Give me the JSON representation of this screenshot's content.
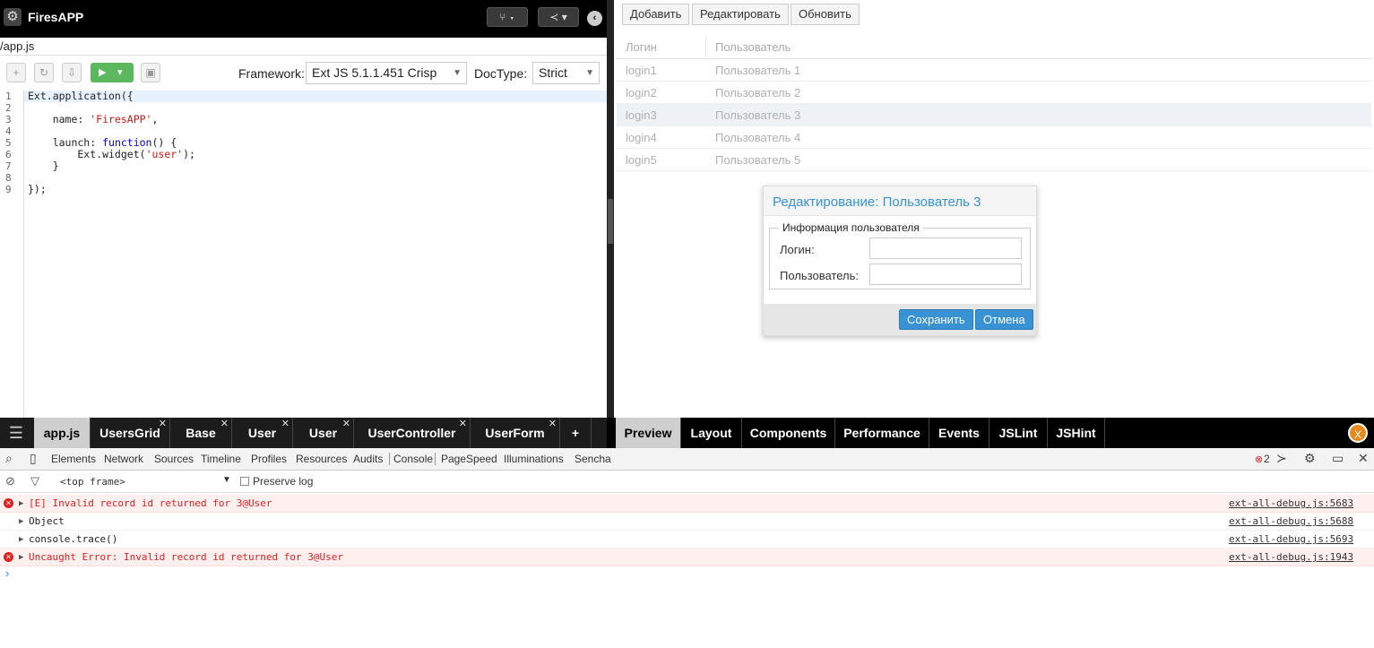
{
  "app": {
    "title": "FiresAPP",
    "gear_icon": "gear-icon",
    "file_path": "/app.js"
  },
  "toolbar": {
    "framework_label": "Framework:",
    "framework_value": "Ext JS 5.1.1.451 Crisp",
    "doctype_label": "DocType:",
    "doctype_value": "Strict"
  },
  "editor": {
    "line_numbers": [
      "1",
      "2",
      "3",
      "4",
      "5",
      "6",
      "7",
      "8",
      "9"
    ],
    "lines": [
      "Ext.application({",
      "",
      "    name: 'FiresAPP',",
      "",
      "    launch: function() {",
      "        Ext.widget('user');",
      "    }",
      "",
      "});"
    ]
  },
  "preview": {
    "buttons": [
      "Добавить",
      "Редактировать",
      "Обновить"
    ],
    "grid": {
      "columns": [
        "Логин",
        "Пользователь"
      ],
      "rows": [
        {
          "login": "login1",
          "user": "Пользователь 1"
        },
        {
          "login": "login2",
          "user": "Пользователь 2"
        },
        {
          "login": "login3",
          "user": "Пользователь 3"
        },
        {
          "login": "login4",
          "user": "Пользователь 4"
        },
        {
          "login": "login5",
          "user": "Пользователь 5"
        }
      ]
    },
    "dialog": {
      "title": "Редактирование: Пользователь 3",
      "legend": "Информация пользователя",
      "login_label": "Логин:",
      "user_label": "Пользователь:",
      "login_value": "",
      "user_value": "",
      "save": "Сохранить",
      "cancel": "Отмена"
    }
  },
  "file_tabs": [
    "app.js",
    "UsersGrid",
    "Base",
    "User",
    "User",
    "UserController",
    "UserForm",
    "+"
  ],
  "preview_tabs": [
    "Preview",
    "Layout",
    "Components",
    "Performance",
    "Events",
    "JSLint",
    "JSHint"
  ],
  "devtools": {
    "tabs": [
      "Elements",
      "Network",
      "Sources",
      "Timeline",
      "Profiles",
      "Resources",
      "Audits",
      "Console",
      "PageSpeed",
      "Illuminations",
      "Sencha"
    ],
    "error_count": "2",
    "frame": "<top frame>",
    "preserve_log": "Preserve log",
    "logs": [
      {
        "msg": "[E] Invalid record id returned for 3@User",
        "src": "ext-all-debug.js:5683",
        "error": true
      },
      {
        "msg": "Object",
        "src": "ext-all-debug.js:5688",
        "error": false
      },
      {
        "msg": "console.trace()",
        "src": "ext-all-debug.js:5693",
        "error": false
      },
      {
        "msg": "Uncaught Error: Invalid record id returned for 3@User",
        "src": "ext-all-debug.js:1943",
        "error": true
      }
    ],
    "prompt": "›"
  },
  "colors": {
    "accent": "#3892d3",
    "run": "#5cb85c",
    "error": "#e02020"
  }
}
